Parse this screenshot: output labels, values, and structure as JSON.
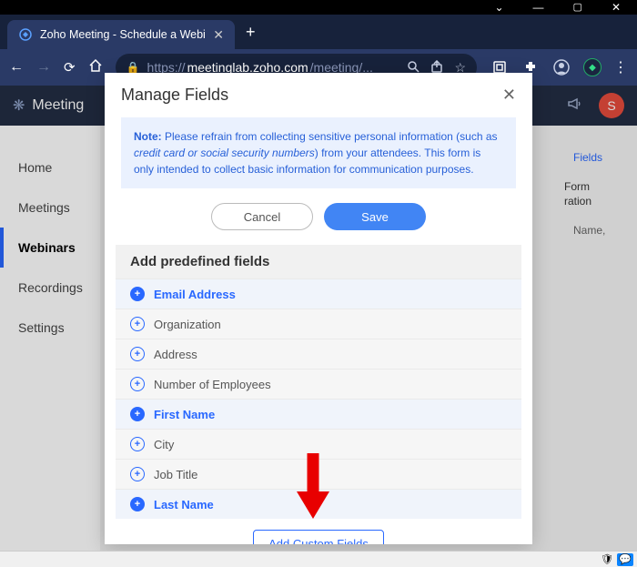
{
  "window": {
    "title": "Zoho Meeting - Schedule a Webi"
  },
  "browser": {
    "tab_title": "Zoho Meeting - Schedule a Webi",
    "url_prefix": "https://",
    "url_domain": "meetinglab.zoho.com",
    "url_path": "/meeting/..."
  },
  "app_header": {
    "brand": "Meeting",
    "avatar_initial": "S"
  },
  "sidebar": {
    "items": [
      {
        "label": "Home"
      },
      {
        "label": "Meetings"
      },
      {
        "label": "Webinars"
      },
      {
        "label": "Recordings"
      },
      {
        "label": "Settings"
      }
    ],
    "active_index": 2
  },
  "modal": {
    "title": "Manage Fields",
    "note": {
      "label": "Note:",
      "text1": " Please refrain from collecting sensitive personal information (such as ",
      "em": "credit card or social security numbers",
      "text2": ") from your attendees. This form is only intended to collect basic information for communication purposes."
    },
    "buttons": {
      "cancel": "Cancel",
      "save": "Save"
    },
    "section_title": "Add predefined fields",
    "fields": [
      {
        "label": "Email Address",
        "filled": true
      },
      {
        "label": "Organization",
        "filled": false
      },
      {
        "label": "Address",
        "filled": false
      },
      {
        "label": "Number of Employees",
        "filled": false
      },
      {
        "label": "First Name",
        "filled": true
      },
      {
        "label": "City",
        "filled": false
      },
      {
        "label": "Job Title",
        "filled": false
      },
      {
        "label": "Last Name",
        "filled": true
      }
    ],
    "add_custom": "Add Custom Fields"
  },
  "bg": {
    "fields_link": "Fields",
    "form_text": "Form",
    "reg_text": "ration",
    "name_hint": "Name,"
  }
}
